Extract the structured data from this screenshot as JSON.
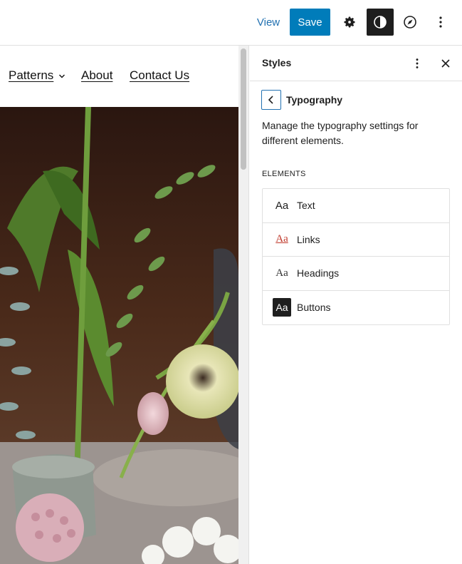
{
  "toolbar": {
    "view_label": "View",
    "save_label": "Save",
    "icons": [
      "gear-icon",
      "styles-contrast-icon",
      "compass-icon",
      "more-vertical-icon"
    ]
  },
  "site_nav": {
    "items": [
      {
        "label": "Patterns",
        "has_submenu": true
      },
      {
        "label": "About"
      },
      {
        "label": "Contact Us"
      }
    ]
  },
  "sidebar": {
    "title": "Styles",
    "section_title": "Typography",
    "description": "Manage the typography settings for different elements.",
    "elements_heading": "ELEMENTS",
    "elements": [
      {
        "preview": "Aa",
        "label": "Text"
      },
      {
        "preview": "Aa",
        "label": "Links"
      },
      {
        "preview": "Aa",
        "label": "Headings"
      },
      {
        "preview": "Aa",
        "label": "Buttons"
      }
    ]
  },
  "colors": {
    "accent": "#007cba",
    "link": "#2271b1",
    "dark": "#1e1e1e",
    "links_preview": "#c0392b"
  }
}
